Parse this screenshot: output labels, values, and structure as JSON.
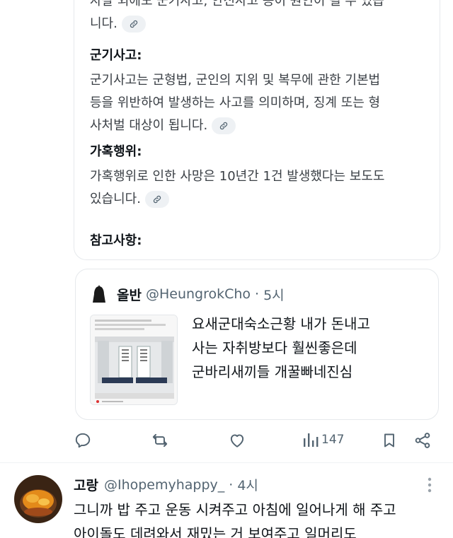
{
  "answer": {
    "para1_line1": "자살 외에도 군기사고, 안전사고 등이 원인이 될 수 있습",
    "para1_line2": "니다.",
    "heading2": "군기사고:",
    "para2_line1": "군기사고는 군형법, 군인의 지위 및 복무에 관한 기본법",
    "para2_line2": "등을 위반하여 발생하는 사고를 의미하며, 징계 또는 형",
    "para2_line3": "사처벌 대상이 됩니다.",
    "heading3": "가혹행위:",
    "para3_line1": "가혹행위로 인한 사망은 10년간 1건 발생했다는 보도도",
    "para3_line2": "있습니다.",
    "heading4": "참고사항:"
  },
  "quote": {
    "name": "올반",
    "handle": "@HeungrokCho",
    "dot": "·",
    "time": "5시",
    "text_line1": "요새군대숙소근황 내가 돈내고",
    "text_line2": "사는 자취방보다 훨씬좋은데",
    "text_line3": "군바리새끼들 개꿀빠네진심"
  },
  "actions": {
    "views": "147"
  },
  "reply": {
    "name": "고랑",
    "handle": "@Ihopemyhappy_",
    "dot": "·",
    "time": "4시",
    "text_line1": "그니까 밥 주고 운동 시켜주고 아침에 일어나게 해 주고",
    "text_line2": "아이돌도 데려와서 재밌는 거 보여주고 일머리도"
  },
  "icons": {
    "link": "link-icon",
    "reply": "reply-icon",
    "retweet": "retweet-icon",
    "like": "heart-icon",
    "views": "views-icon",
    "bookmark": "bookmark-icon",
    "share": "share-icon",
    "more": "more-icon"
  },
  "colors": {
    "text": "#0f1419",
    "secondary": "#536471",
    "border": "#e6e9ec"
  }
}
